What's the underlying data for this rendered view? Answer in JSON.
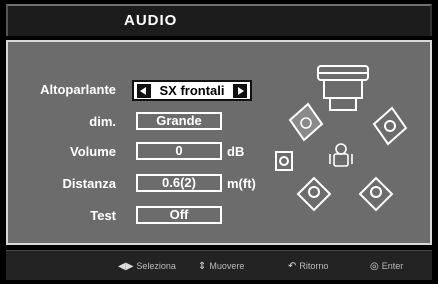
{
  "title": "AUDIO",
  "rows": {
    "speaker": {
      "label": "Altoparlante",
      "value": "SX frontali"
    },
    "size": {
      "label": "dim.",
      "value": "Grande"
    },
    "volume": {
      "label": "Volume",
      "value": "0",
      "unit": "dB"
    },
    "distance": {
      "label": "Distanza",
      "value": "0.6(2)",
      "unit": "m(ft)"
    },
    "test": {
      "label": "Test",
      "value": "Off"
    }
  },
  "help": {
    "select": {
      "icon": "left-right-arrows-icon",
      "label": "Seleziona"
    },
    "move": {
      "icon": "up-down-arrows-icon",
      "label": "Muovere"
    },
    "return": {
      "icon": "return-icon",
      "label": "Ritorno"
    },
    "enter": {
      "icon": "enter-icon",
      "label": "Enter"
    }
  },
  "colors": {
    "panel": "#6c6c6c",
    "highlight_speaker": "#8a8a8a",
    "background": "#000000"
  }
}
